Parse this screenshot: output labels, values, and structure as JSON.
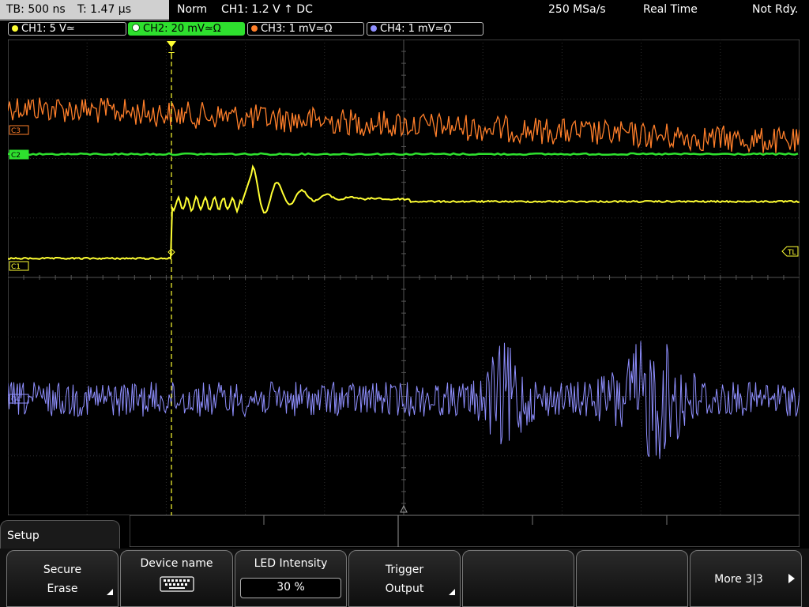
{
  "top": {
    "timebase": "TB: 500 ns",
    "trigger_time": "T: 1.47 µs",
    "mode": "Norm",
    "trigger": "CH1: 1.2 V ↑ DC",
    "sample_rate": "250 MSa/s",
    "acq": "Real Time",
    "status": "Not Rdy."
  },
  "channels": [
    {
      "label": "CH1: 5 V≃",
      "color": "#ffff33"
    },
    {
      "label": "CH2: 20 mV≃Ω",
      "color": "#2ee02e"
    },
    {
      "label": "CH3: 1 mV≃Ω",
      "color": "#ff7f2a"
    },
    {
      "label": "CH4: 1 mV≃Ω",
      "color": "#8f8fff"
    }
  ],
  "markers": {
    "c1": "C1",
    "c2": "C2",
    "c3": "C3",
    "c4": "C4",
    "tl": "TL",
    "trig": "T"
  },
  "menu": {
    "tab": "Setup",
    "keys": [
      {
        "l1": "Secure",
        "l2": "Erase"
      },
      {
        "l1": "Device name",
        "icon": "keyboard-icon"
      },
      {
        "l1": "LED Intensity",
        "value": "30 %"
      },
      {
        "l1": "Trigger",
        "l2": "Output"
      },
      {
        "l1": ""
      },
      {
        "l1": ""
      },
      {
        "l1": "More 3|3"
      }
    ]
  }
}
